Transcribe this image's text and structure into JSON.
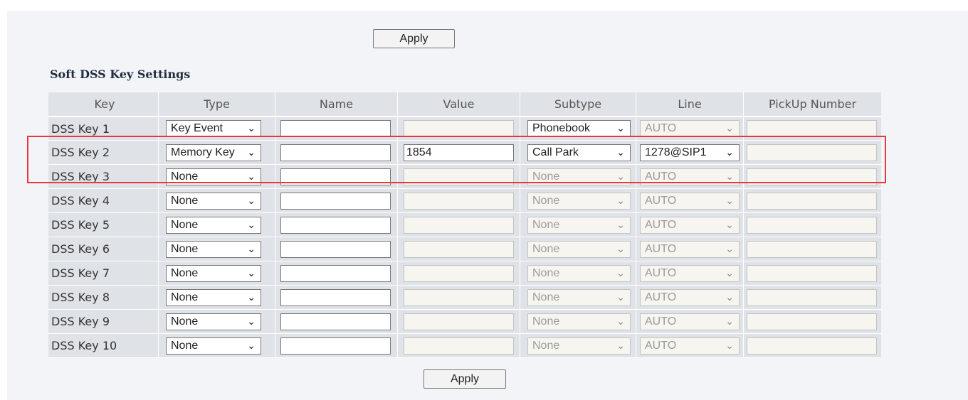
{
  "apply_label": "Apply",
  "section_title": "Soft DSS Key Settings",
  "columns": [
    "Key",
    "Type",
    "Name",
    "Value",
    "Subtype",
    "Line",
    "PickUp Number"
  ],
  "rows": [
    {
      "key": "DSS Key 1",
      "type": "Key Event",
      "name": "",
      "value": "",
      "value_enabled": false,
      "subtype": "Phonebook",
      "subtype_enabled": true,
      "line": "AUTO",
      "line_enabled": false,
      "pickup": "",
      "pickup_enabled": false
    },
    {
      "key": "DSS Key 2",
      "type": "Memory Key",
      "name": "",
      "value": "1854",
      "value_enabled": true,
      "subtype": "Call Park",
      "subtype_enabled": true,
      "line": "1278@SIP1",
      "line_enabled": true,
      "pickup": "",
      "pickup_enabled": false
    },
    {
      "key": "DSS Key 3",
      "type": "None",
      "name": "",
      "value": "",
      "value_enabled": false,
      "subtype": "None",
      "subtype_enabled": false,
      "line": "AUTO",
      "line_enabled": false,
      "pickup": "",
      "pickup_enabled": false
    },
    {
      "key": "DSS Key 4",
      "type": "None",
      "name": "",
      "value": "",
      "value_enabled": false,
      "subtype": "None",
      "subtype_enabled": false,
      "line": "AUTO",
      "line_enabled": false,
      "pickup": "",
      "pickup_enabled": false
    },
    {
      "key": "DSS Key 5",
      "type": "None",
      "name": "",
      "value": "",
      "value_enabled": false,
      "subtype": "None",
      "subtype_enabled": false,
      "line": "AUTO",
      "line_enabled": false,
      "pickup": "",
      "pickup_enabled": false
    },
    {
      "key": "DSS Key 6",
      "type": "None",
      "name": "",
      "value": "",
      "value_enabled": false,
      "subtype": "None",
      "subtype_enabled": false,
      "line": "AUTO",
      "line_enabled": false,
      "pickup": "",
      "pickup_enabled": false
    },
    {
      "key": "DSS Key 7",
      "type": "None",
      "name": "",
      "value": "",
      "value_enabled": false,
      "subtype": "None",
      "subtype_enabled": false,
      "line": "AUTO",
      "line_enabled": false,
      "pickup": "",
      "pickup_enabled": false
    },
    {
      "key": "DSS Key 8",
      "type": "None",
      "name": "",
      "value": "",
      "value_enabled": false,
      "subtype": "None",
      "subtype_enabled": false,
      "line": "AUTO",
      "line_enabled": false,
      "pickup": "",
      "pickup_enabled": false
    },
    {
      "key": "DSS Key 9",
      "type": "None",
      "name": "",
      "value": "",
      "value_enabled": false,
      "subtype": "None",
      "subtype_enabled": false,
      "line": "AUTO",
      "line_enabled": false,
      "pickup": "",
      "pickup_enabled": false
    },
    {
      "key": "DSS Key 10",
      "type": "None",
      "name": "",
      "value": "",
      "value_enabled": false,
      "subtype": "None",
      "subtype_enabled": false,
      "line": "AUTO",
      "line_enabled": false,
      "pickup": "",
      "pickup_enabled": false
    }
  ],
  "colors": {
    "panel_bg": "#f2f4f7",
    "table_bg": "#dfe3e8",
    "highlight": "#e8383d",
    "disabled_field": "#f7f5ef"
  },
  "icons": {
    "select_arrow": "chevron-down-icon"
  }
}
